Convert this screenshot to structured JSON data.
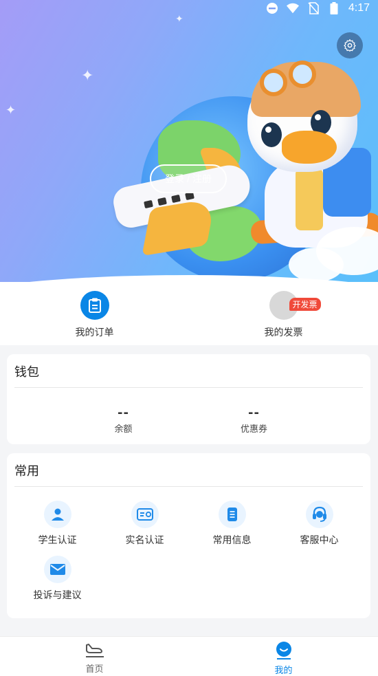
{
  "status_bar": {
    "time": "4:17",
    "icons": [
      "dnd-icon",
      "wifi-icon",
      "no-sim-icon",
      "battery-icon"
    ]
  },
  "hero": {
    "login_label": "登录 / 注册",
    "settings_icon": "gear-icon"
  },
  "quick_actions": [
    {
      "label": "我的订单",
      "icon": "clipboard-icon"
    },
    {
      "label": "我的发票",
      "icon": "invoice-icon",
      "badge": "开发票"
    }
  ],
  "wallet": {
    "title": "钱包",
    "items": [
      {
        "value": "--",
        "label": "余额"
      },
      {
        "value": "--",
        "label": "优惠券"
      }
    ]
  },
  "common": {
    "title": "常用",
    "items": [
      {
        "label": "学生认证",
        "icon": "student-icon"
      },
      {
        "label": "实名认证",
        "icon": "id-card-icon"
      },
      {
        "label": "常用信息",
        "icon": "document-icon"
      },
      {
        "label": "客服中心",
        "icon": "headset-icon"
      },
      {
        "label": "投诉与建议",
        "icon": "mail-icon"
      }
    ]
  },
  "tabbar": {
    "tabs": [
      {
        "label": "首页",
        "icon": "airplane-landing-icon",
        "active": false
      },
      {
        "label": "我的",
        "icon": "profile-smile-icon",
        "active": true
      }
    ]
  },
  "colors": {
    "accent": "#0a86e6",
    "icon_bg": "#e9f4ff",
    "badge": "#f04a3a",
    "tab_inactive": "#666666"
  }
}
